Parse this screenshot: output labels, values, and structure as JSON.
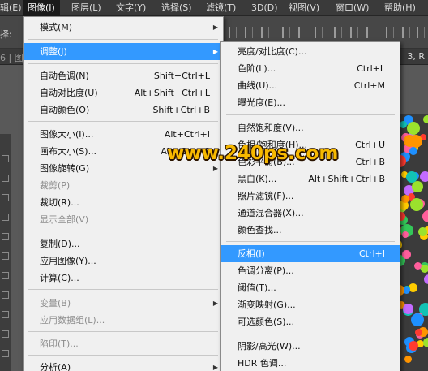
{
  "menubar": [
    "辑(E)",
    "图像(I)",
    "图层(L)",
    "文字(Y)",
    "选择(S)",
    "滤镜(T)",
    "3D(D)",
    "视图(V)",
    "窗口(W)",
    "帮助(H)"
  ],
  "options_label": "择:",
  "doc_tab_left": "6 | 图",
  "doc_tab_right": "3, R",
  "watermark": "www.240ps.com",
  "image_menu": {
    "items": [
      {
        "label": "模式(M)"
      },
      {
        "label": "调整(J)"
      },
      {
        "label": "自动色调(N)",
        "shortcut": "Shift+Ctrl+L"
      },
      {
        "label": "自动对比度(U)",
        "shortcut": "Alt+Shift+Ctrl+L"
      },
      {
        "label": "自动颜色(O)",
        "shortcut": "Shift+Ctrl+B"
      },
      {
        "label": "图像大小(I)...",
        "shortcut": "Alt+Ctrl+I"
      },
      {
        "label": "画布大小(S)...",
        "shortcut": "Alt+Ctrl+C"
      },
      {
        "label": "图像旋转(G)"
      },
      {
        "label": "裁剪(P)"
      },
      {
        "label": "裁切(R)..."
      },
      {
        "label": "显示全部(V)"
      },
      {
        "label": "复制(D)..."
      },
      {
        "label": "应用图像(Y)..."
      },
      {
        "label": "计算(C)..."
      },
      {
        "label": "变量(B)"
      },
      {
        "label": "应用数据组(L)..."
      },
      {
        "label": "陷印(T)..."
      },
      {
        "label": "分析(A)"
      }
    ]
  },
  "adjust_menu": {
    "items": [
      {
        "label": "亮度/对比度(C)..."
      },
      {
        "label": "色阶(L)...",
        "shortcut": "Ctrl+L"
      },
      {
        "label": "曲线(U)...",
        "shortcut": "Ctrl+M"
      },
      {
        "label": "曝光度(E)..."
      },
      {
        "label": "自然饱和度(V)..."
      },
      {
        "label": "色相/饱和度(H)...",
        "shortcut": "Ctrl+U"
      },
      {
        "label": "色彩平衡(B)...",
        "shortcut": "Ctrl+B"
      },
      {
        "label": "黑白(K)...",
        "shortcut": "Alt+Shift+Ctrl+B"
      },
      {
        "label": "照片滤镜(F)..."
      },
      {
        "label": "通道混合器(X)..."
      },
      {
        "label": "颜色查找..."
      },
      {
        "label": "反相(I)",
        "shortcut": "Ctrl+I"
      },
      {
        "label": "色调分离(P)..."
      },
      {
        "label": "阈值(T)..."
      },
      {
        "label": "渐变映射(G)..."
      },
      {
        "label": "可选颜色(S)..."
      },
      {
        "label": "阴影/高光(W)..."
      },
      {
        "label": "HDR 色调..."
      }
    ]
  },
  "colors": {
    "menu_highlight": "#3399ff",
    "menu_background": "#f0f0f0",
    "watermark_fill": "#f7b900",
    "chrome_dark": "#3a3a3a",
    "artwork_palette": [
      "#ff3b30",
      "#ff9500",
      "#ffcc00",
      "#9be22d",
      "#34c759",
      "#12c2b4",
      "#1e90ff",
      "#c46bff",
      "#ff5e9c"
    ]
  }
}
